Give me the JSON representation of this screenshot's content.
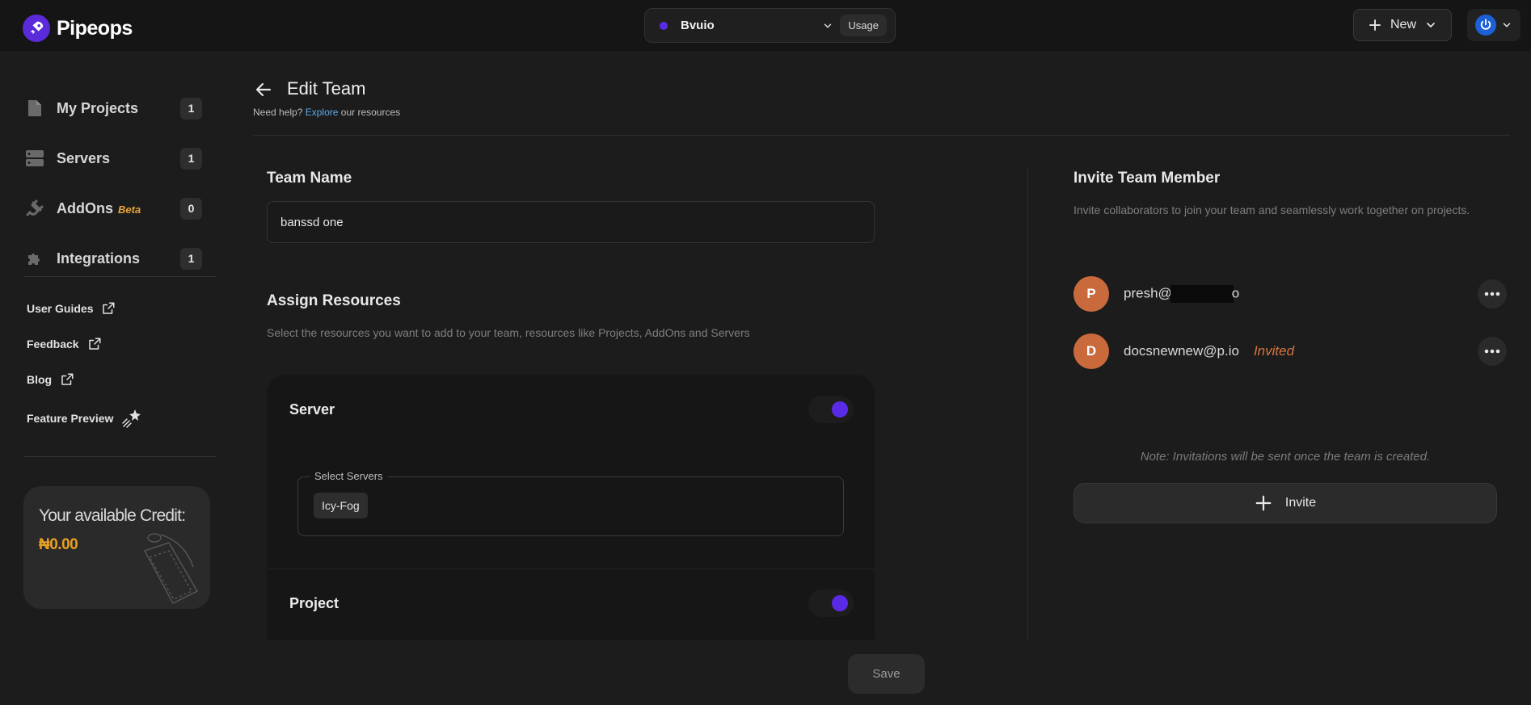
{
  "app": {
    "logo_text": "Pipeops"
  },
  "topbar": {
    "workspace_name": "Bvuio",
    "usage_label": "Usage",
    "new_label": "New",
    "accent_color": "#5a2be6"
  },
  "sidebar": {
    "nav": [
      {
        "label": "My Projects",
        "count": "1",
        "icon": "file-icon"
      },
      {
        "label": "Servers",
        "count": "1",
        "icon": "server-icon"
      },
      {
        "label": "AddOns",
        "badge": "Beta",
        "count": "0",
        "icon": "plug-icon"
      },
      {
        "label": "Integrations",
        "count": "1",
        "icon": "puzzle-icon"
      }
    ],
    "links": [
      {
        "label": "User Guides",
        "icon": "external-link-icon"
      },
      {
        "label": "Feedback",
        "icon": "external-link-icon"
      },
      {
        "label": "Blog",
        "icon": "external-link-icon"
      },
      {
        "label": "Feature Preview",
        "icon": "sparkle-icon"
      }
    ],
    "credit": {
      "title": "Your available Credit:",
      "value": "₦0.00"
    }
  },
  "header": {
    "title": "Edit Team",
    "help_prefix": "Need help?",
    "help_link": "Explore",
    "help_suffix": "our resources"
  },
  "team": {
    "name_label": "Team Name",
    "name_value": "banssd one"
  },
  "resources": {
    "title": "Assign Resources",
    "description": "Select the resources you want to add to your team, resources like Projects, AddOns and Servers",
    "server_label": "Server",
    "server_enabled": true,
    "select_servers_label": "Select Servers",
    "selected_servers": [
      "Icy-Fog"
    ],
    "project_label": "Project",
    "project_enabled": true
  },
  "invite": {
    "title": "Invite Team Member",
    "description": "Invite collaborators to join your team and seamlessly work together on projects.",
    "members": [
      {
        "initial": "P",
        "email_start": "presh@",
        "email_end": "o",
        "status": ""
      },
      {
        "initial": "D",
        "email_start": "docsnewnew@p.io",
        "email_end": "",
        "status": "Invited"
      }
    ],
    "note": "Note: Invitations will be sent once the team is created.",
    "button_label": "Invite"
  },
  "footer": {
    "save_label": "Save"
  }
}
